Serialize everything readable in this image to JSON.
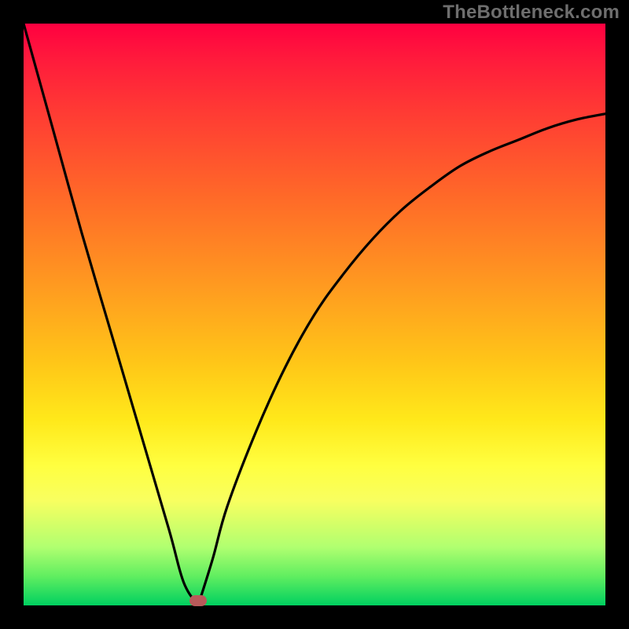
{
  "watermark": "TheBottleneck.com",
  "colors": {
    "frame_bg": "#000000",
    "gradient_top": "#ff0040",
    "gradient_mid1": "#ff9a20",
    "gradient_mid2": "#ffff40",
    "gradient_bottom": "#00d060",
    "curve": "#000000",
    "bump": "#b85a5a"
  },
  "chart_data": {
    "type": "line",
    "title": "",
    "xlabel": "",
    "ylabel": "",
    "xlim": [
      0,
      100
    ],
    "ylim": [
      0,
      100
    ],
    "grid": false,
    "legend": false,
    "annotations": [
      {
        "name": "watermark",
        "text": "TheBottleneck.com",
        "position": "top-right"
      }
    ],
    "series": [
      {
        "name": "left-branch",
        "x": [
          0,
          5,
          10,
          15,
          20,
          25,
          27.5,
          30
        ],
        "values": [
          100,
          82,
          64,
          47,
          30,
          13,
          4,
          0
        ]
      },
      {
        "name": "right-branch",
        "x": [
          30,
          32.5,
          35,
          40,
          45,
          50,
          55,
          60,
          65,
          70,
          75,
          80,
          85,
          90,
          95,
          100
        ],
        "values": [
          0,
          8,
          17,
          30,
          41,
          50,
          57,
          63,
          68,
          72,
          75.5,
          78,
          80,
          82,
          83.5,
          84.5
        ]
      }
    ],
    "marker": {
      "name": "optimum-point",
      "x": 30,
      "y": 0,
      "color": "#b85a5a"
    }
  }
}
